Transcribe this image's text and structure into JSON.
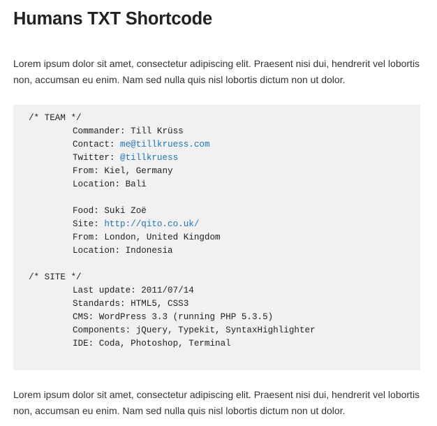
{
  "title": "Humans TXT Shortcode",
  "paragraph_1": "Lorem ipsum dolor sit amet, consectetur adipiscing elit. Praesent nisi dui, hendrerit vel lobortis non, accumsan eu enim. Nam sed nulla quis nisl lobortis dictum non ut dolor.",
  "paragraph_2": "Lorem ipsum dolor sit amet, consectetur adipiscing elit. Praesent nisi dui, hendrerit vel lobortis non, accumsan eu enim. Nam sed nulla quis nisl lobortis dictum non ut dolor.",
  "code": {
    "team_header": "/* TEAM */",
    "person_1": {
      "commander": "Commander: Till Krüss",
      "contact_label": "Contact: ",
      "contact_link": "me@tillkruess.com",
      "twitter_label": "Twitter: ",
      "twitter_link": "@tillkruess",
      "from": "From: Kiel, Germany",
      "location": "Location: Bali"
    },
    "person_2": {
      "food": "Food: Suki Zoë",
      "site_label": "Site: ",
      "site_link": "http://qito.co.uk/",
      "from": "From: London, United Kingdom",
      "location": "Location: Indonesia"
    },
    "site_header": "/* SITE */",
    "site": {
      "last_update": "Last update: 2011/07/14",
      "standards": "Standards: HTML5, CSS3",
      "cms": "CMS: WordPress 3.3 (running PHP 5.3.5)",
      "components": "Components: jQuery, Typekit, SyntaxHighlighter",
      "ide": "IDE: Coda, Photoshop, Terminal"
    }
  },
  "colors": {
    "link": "#1e74b8",
    "code_background": "#f1f1f1"
  }
}
